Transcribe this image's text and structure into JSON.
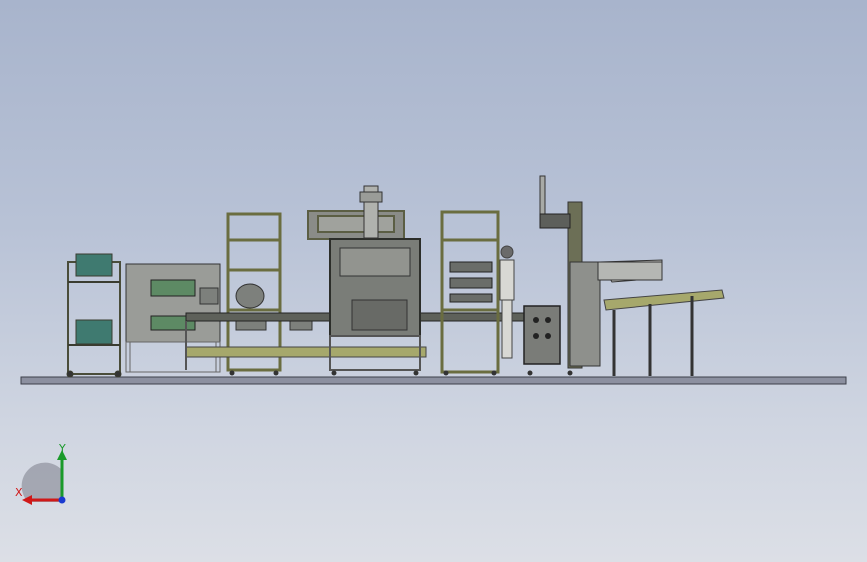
{
  "viewport": {
    "background_top": "#a8b4cc",
    "background_bottom": "#dcdfe6"
  },
  "colors": {
    "frame_olive": "#8b8e5a",
    "frame_dark": "#4a4d3a",
    "panel_gray": "#9a9c98",
    "panel_dark": "#6e716e",
    "bin_teal": "#3f7a70",
    "base_plate": "#8c90a0",
    "conveyor_olive": "#a6a86c"
  },
  "triad": {
    "x_label": "X",
    "y_label": "Y",
    "x_color": "#d01818",
    "y_color": "#1a9a2a",
    "z_color": "#1a3ad0",
    "icons": [
      "coordinate-triad-icon"
    ]
  }
}
